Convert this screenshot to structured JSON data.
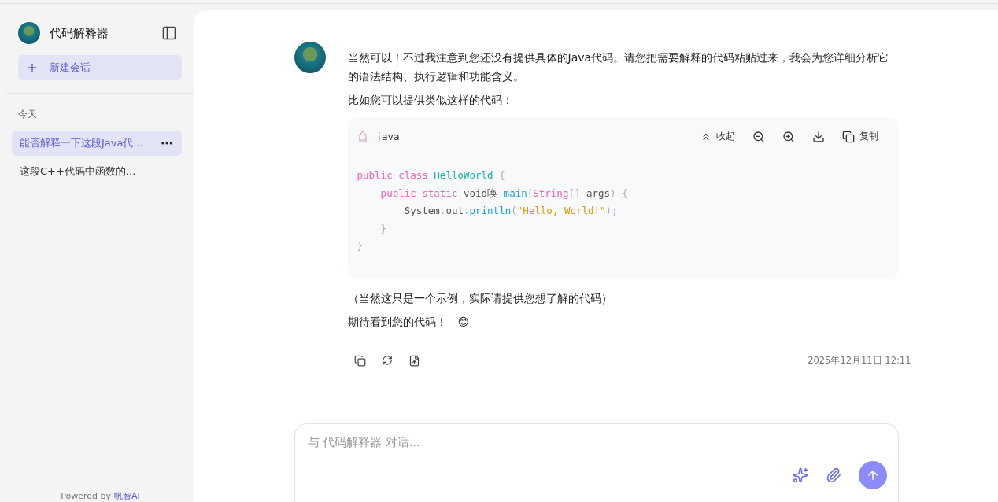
{
  "sidebar": {
    "app_title": "代码解释器",
    "new_chat": "新建会话",
    "group_label": "今天",
    "conversations": [
      {
        "title": "能否解释一下这段Java代...",
        "selected": true
      },
      {
        "title": "这段C++代码中函数的...",
        "selected": false
      }
    ],
    "footer": {
      "text": "Powered by",
      "link": "帆智AI"
    }
  },
  "message": {
    "paragraphs": [
      "当然可以！不过我注意到您还没有提供具体的Java代码。请您把需要解释的代码粘贴过来，我会为您详细分析它的语法结构、执行逻辑和功能含义。",
      "比如您可以提供类似这样的代码："
    ],
    "code_block": {
      "language": "java",
      "collapse_label": "收起",
      "copy_label": "复制",
      "lines": [
        [
          {
            "kind": "keyword",
            "text": "public class "
          },
          {
            "kind": "type",
            "text": "HelloWorld"
          },
          {
            "kind": "punct",
            "text": " {"
          }
        ],
        [
          {
            "kind": "keyword",
            "text": "    public static "
          },
          {
            "kind": "plain",
            "text": "void唤 "
          },
          {
            "kind": "func",
            "text": "main"
          },
          {
            "kind": "punct",
            "text": "("
          },
          {
            "kind": "keyword",
            "text": "String"
          },
          {
            "kind": "punct",
            "text": "[] "
          },
          {
            "kind": "plain",
            "text": "args"
          },
          {
            "kind": "punct",
            "text": ") {"
          }
        ],
        [
          {
            "kind": "plain",
            "text": "        System"
          },
          {
            "kind": "punct",
            "text": "."
          },
          {
            "kind": "plain",
            "text": "out"
          },
          {
            "kind": "punct",
            "text": "."
          },
          {
            "kind": "func",
            "text": "println"
          },
          {
            "kind": "punct",
            "text": "("
          },
          {
            "kind": "string",
            "text": "\"Hello, World!\""
          },
          {
            "kind": "punct",
            "text": ");"
          }
        ],
        [
          {
            "kind": "punct",
            "text": "    }"
          }
        ],
        [
          {
            "kind": "punct",
            "text": "}"
          }
        ]
      ]
    },
    "after": [
      "（当然这只是一个示例，实际请提供您想了解的代码）"
    ],
    "closing": "期待看到您的代码！",
    "emoji": "😊",
    "timestamp": "2025年12月11日 12:11"
  },
  "composer": {
    "placeholder": "与 代码解释器 对话..."
  }
}
